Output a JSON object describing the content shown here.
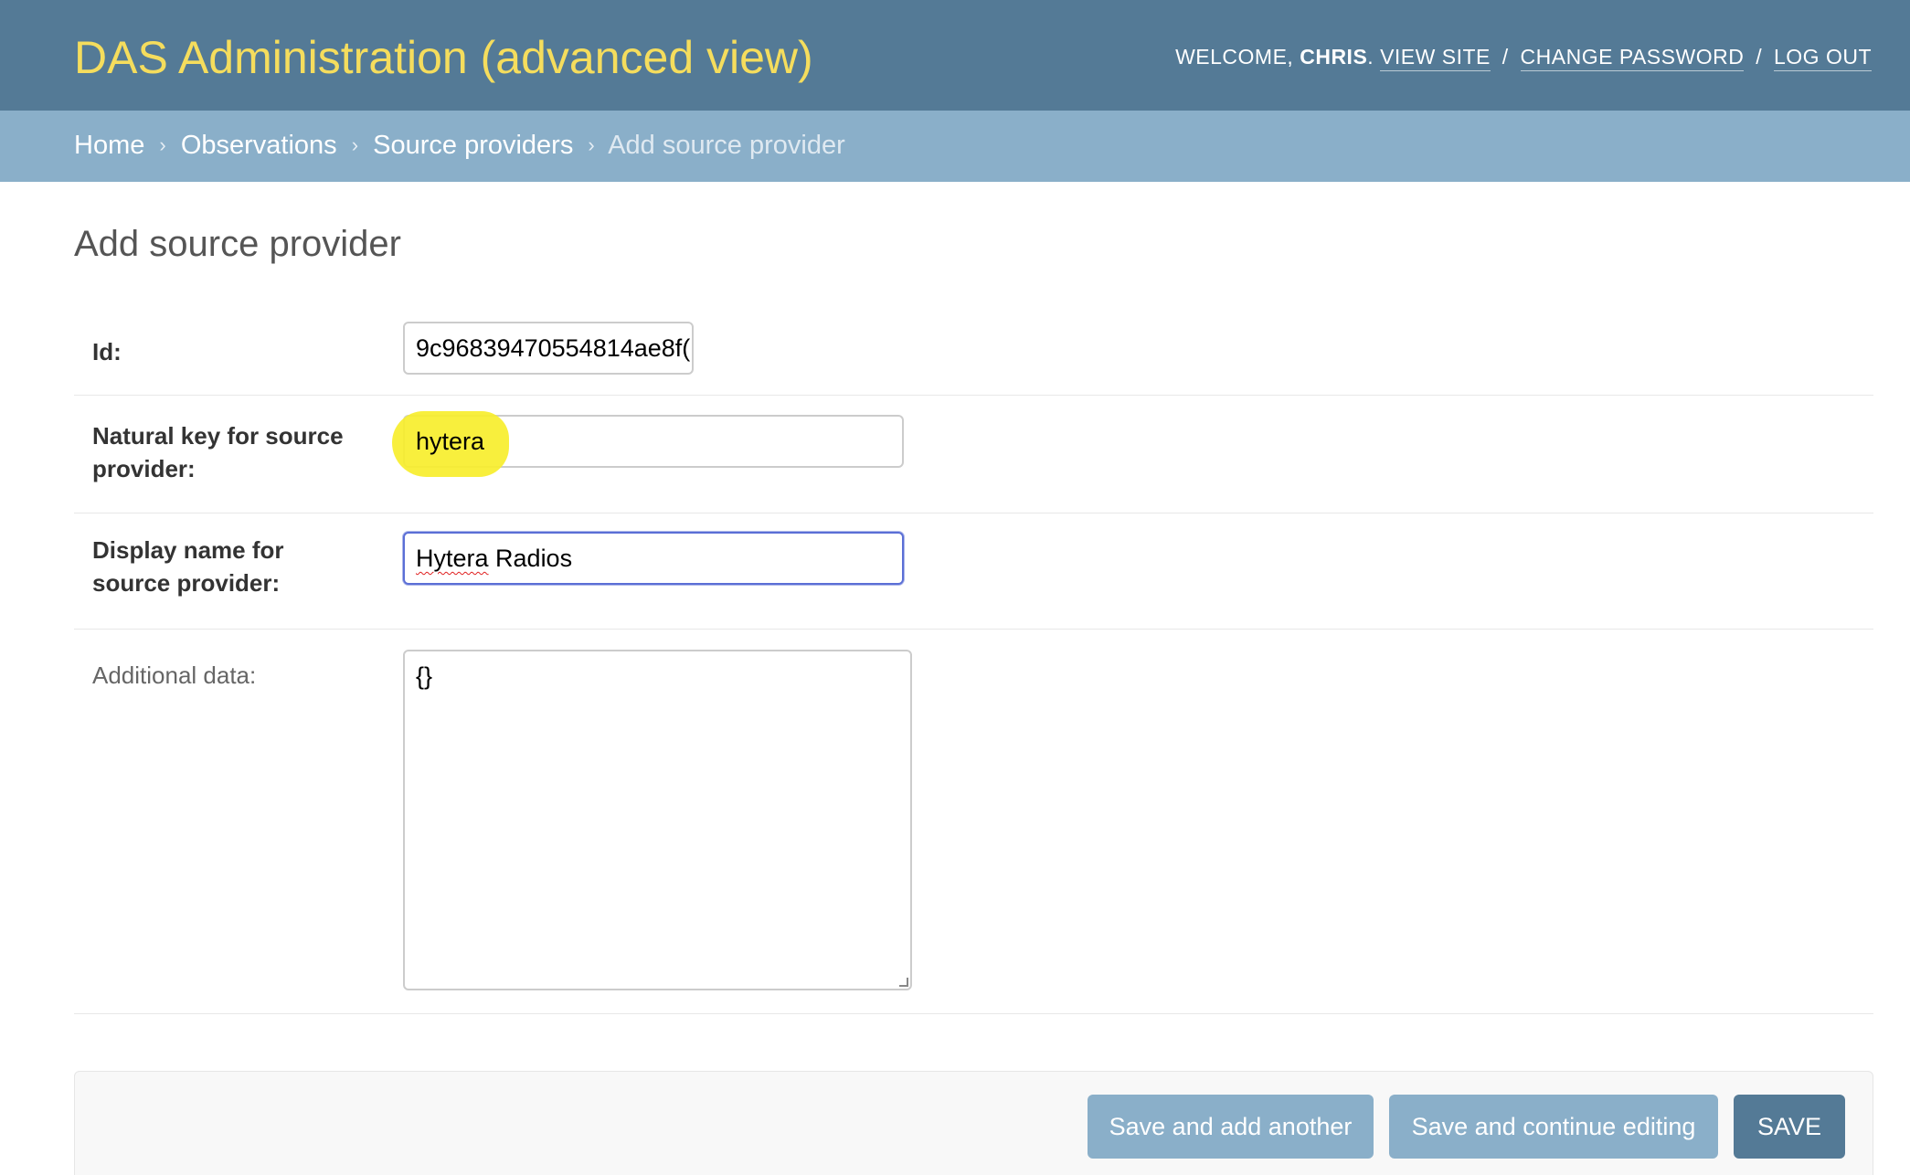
{
  "header": {
    "branding": "DAS Administration (advanced view)",
    "welcome_text": "WELCOME,",
    "user_name": "CHRIS",
    "user_suffix": ".",
    "view_site": "VIEW SITE",
    "change_password": "CHANGE PASSWORD",
    "log_out": "LOG OUT",
    "separator": "/"
  },
  "breadcrumbs": {
    "items": [
      "Home",
      "Observations",
      "Source providers"
    ],
    "current": "Add source provider",
    "arrow": "›"
  },
  "page": {
    "title": "Add source provider"
  },
  "form": {
    "id": {
      "label": "Id:",
      "value": "9c96839470554814ae8f("
    },
    "natural_key": {
      "label": "Natural key for source provider:",
      "value": "hytera"
    },
    "display_name": {
      "label": "Display name for source provider:",
      "value_word1": "Hytera",
      "value_rest": " Radios"
    },
    "additional_data": {
      "label": "Additional data:",
      "value": "{}"
    }
  },
  "submit": {
    "save_add_another": "Save and add another",
    "save_continue": "Save and continue editing",
    "save": "SAVE"
  },
  "colors": {
    "header_bg": "#547a96",
    "branding": "#f5dd5d",
    "breadcrumbs_bg": "#8aafc9",
    "highlight": "#f7ee2d"
  }
}
